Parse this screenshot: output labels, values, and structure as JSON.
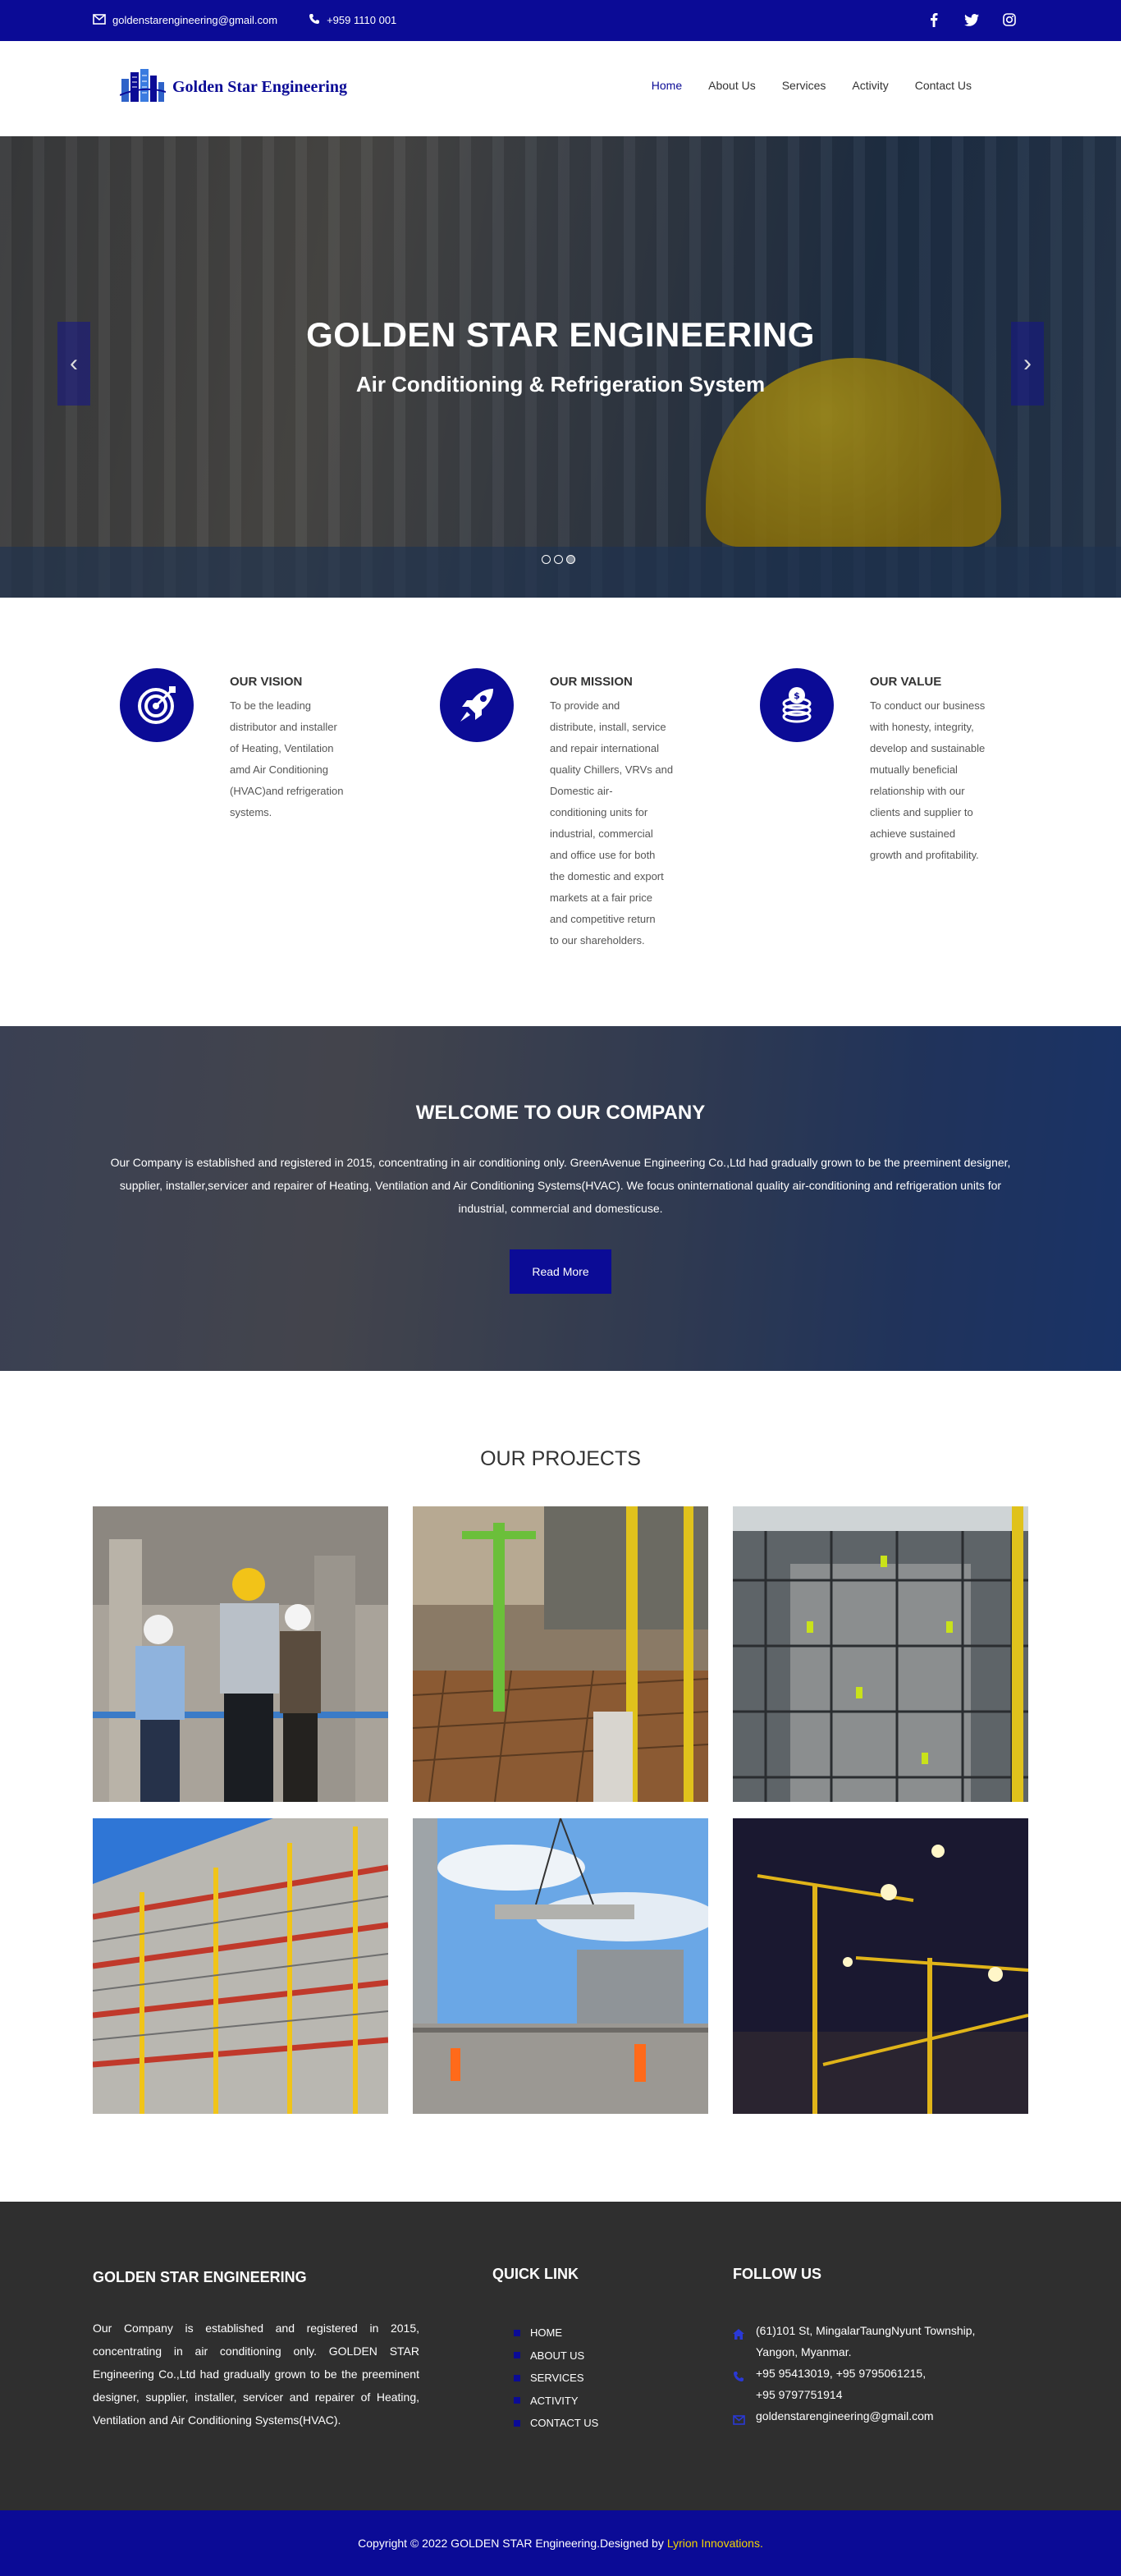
{
  "topbar": {
    "email": "goldenstarengineering@gmail.com",
    "phone": "+959 1110 001",
    "social": [
      "facebook-icon",
      "twitter-icon",
      "instagram-icon"
    ]
  },
  "nav": {
    "brand": "Golden Star Engineering",
    "menu": [
      "Home",
      "About Us",
      "Services",
      "Activity",
      "Contact Us"
    ],
    "active": "Home"
  },
  "hero": {
    "title": "GOLDEN STAR ENGINEERING",
    "subtitle": "Air Conditioning & Refrigeration System",
    "prev_icon": "chevron-left-icon",
    "next_icon": "chevron-right-icon",
    "slides": 3,
    "active_slide": 3
  },
  "features": [
    {
      "icon": "target-icon",
      "title": "OUR VISION",
      "lines": [
        "To be the leading",
        "distributor and installer",
        "of Heating, Ventilation",
        "amd Air Conditioning",
        "(HVAC)and refrigeration",
        "systems."
      ]
    },
    {
      "icon": "rocket-icon",
      "title": "OUR MISSION",
      "lines": [
        "To provide and",
        "distribute, install, service",
        "and repair international",
        "quality Chillers, VRVs and",
        "Domestic air-",
        "conditioning units for",
        "industrial, commercial",
        "and office use for both",
        "the domestic and export",
        "markets at a fair price",
        "and competitive return",
        "to our shareholders."
      ]
    },
    {
      "icon": "coins-icon",
      "title": "OUR VALUE",
      "lines": [
        "To conduct our business",
        "with honesty, integrity,",
        "develop and sustainable",
        "mutually beneficial",
        "relationship with our",
        "clients and supplier to",
        "achieve sustained",
        "growth and profitability."
      ]
    }
  ],
  "welcome": {
    "title": "WELCOME TO OUR COMPANY",
    "text": "Our Company is established and registered in 2015, concentrating in air conditioning only. GreenAvenue Engineering Co.,Ltd had gradually grown to be the preeminent designer, supplier, installer,servicer and repairer of Heating, Ventilation and Air Conditioning Systems(HVAC). We focus oninternational quality air-conditioning and refrigeration units for industrial, commercial and domesticuse.",
    "button": "Read More"
  },
  "projects": {
    "title": "OUR PROJECTS",
    "images": [
      "engineers-on-site-photo",
      "green-crane-rebar-photo",
      "scaffold-workers-photo",
      "red-scaffold-building-photo",
      "crane-lifting-slab-photo",
      "cranes-at-night-photo"
    ]
  },
  "footer": {
    "brand_title": "GOLDEN STAR ENGINEERING",
    "about": "Our Company is established and registered in 2015, concentrating in air conditioning only. GOLDEN STAR Engineering Co.,Ltd had gradually grown to be the preeminent designer, supplier, installer, servicer and repairer of Heating, Ventilation and Air Conditioning Systems(HVAC).",
    "quick_title": "QUICK LINK",
    "links": [
      "HOME",
      "ABOUT US",
      "SERVICES",
      "ACTIVITY",
      "CONTACT US"
    ],
    "follow_title": "FOLLOW US",
    "address_1": "(61)101 St, MingalarTaungNyunt Township,",
    "address_2": "Yangon, Myanmar.",
    "phone_1": "+95 95413019, +95 9795061215,",
    "phone_2": "+95 9797751914",
    "email": "goldenstarengineering@gmail.com"
  },
  "copyright": {
    "text": "Copyright © 2022 GOLDEN STAR Engineering.Designed by",
    "designer": "Lyrion Innovations."
  },
  "colors": {
    "primary": "#0b0b96",
    "footer": "#2f2f2f",
    "highlight": "#f2d400"
  }
}
